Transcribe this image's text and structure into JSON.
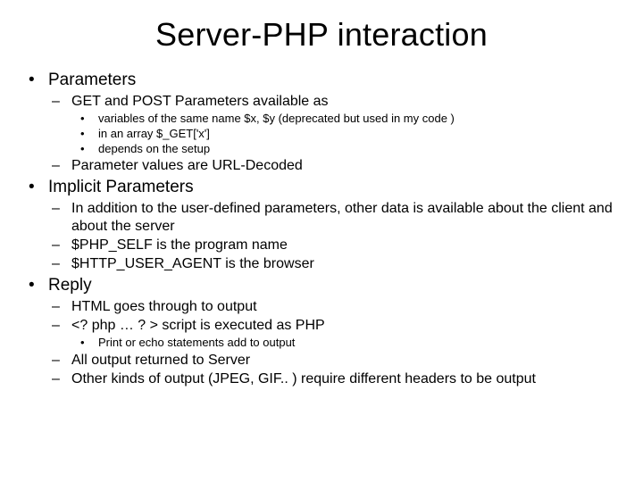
{
  "title": "Server-PHP interaction",
  "bullets": [
    {
      "text": "Parameters",
      "children": [
        {
          "text": "GET and POST Parameters available as",
          "children": [
            {
              "text": "variables of the same name $x, $y (deprecated but used in my code )"
            },
            {
              "text": "in an array $_GET['x']"
            },
            {
              "text": "depends on the setup"
            }
          ]
        },
        {
          "text": "Parameter values are URL-Decoded"
        }
      ]
    },
    {
      "text": "Implicit Parameters",
      "children": [
        {
          "text": "In addition to the user-defined parameters, other data is available about the client and about the server"
        },
        {
          "text": "$PHP_SELF is the program name"
        },
        {
          "text": "$HTTP_USER_AGENT is the browser"
        }
      ]
    },
    {
      "text": "Reply",
      "children": [
        {
          "text": "HTML goes through to output"
        },
        {
          "text": "<? php  … ? > script is executed as PHP",
          "children": [
            {
              "text": "Print or echo statements add to output"
            }
          ]
        },
        {
          "text": "All output returned to Server"
        },
        {
          "text": "Other kinds of output (JPEG, GIF.. ) require different headers to be output"
        }
      ]
    }
  ]
}
